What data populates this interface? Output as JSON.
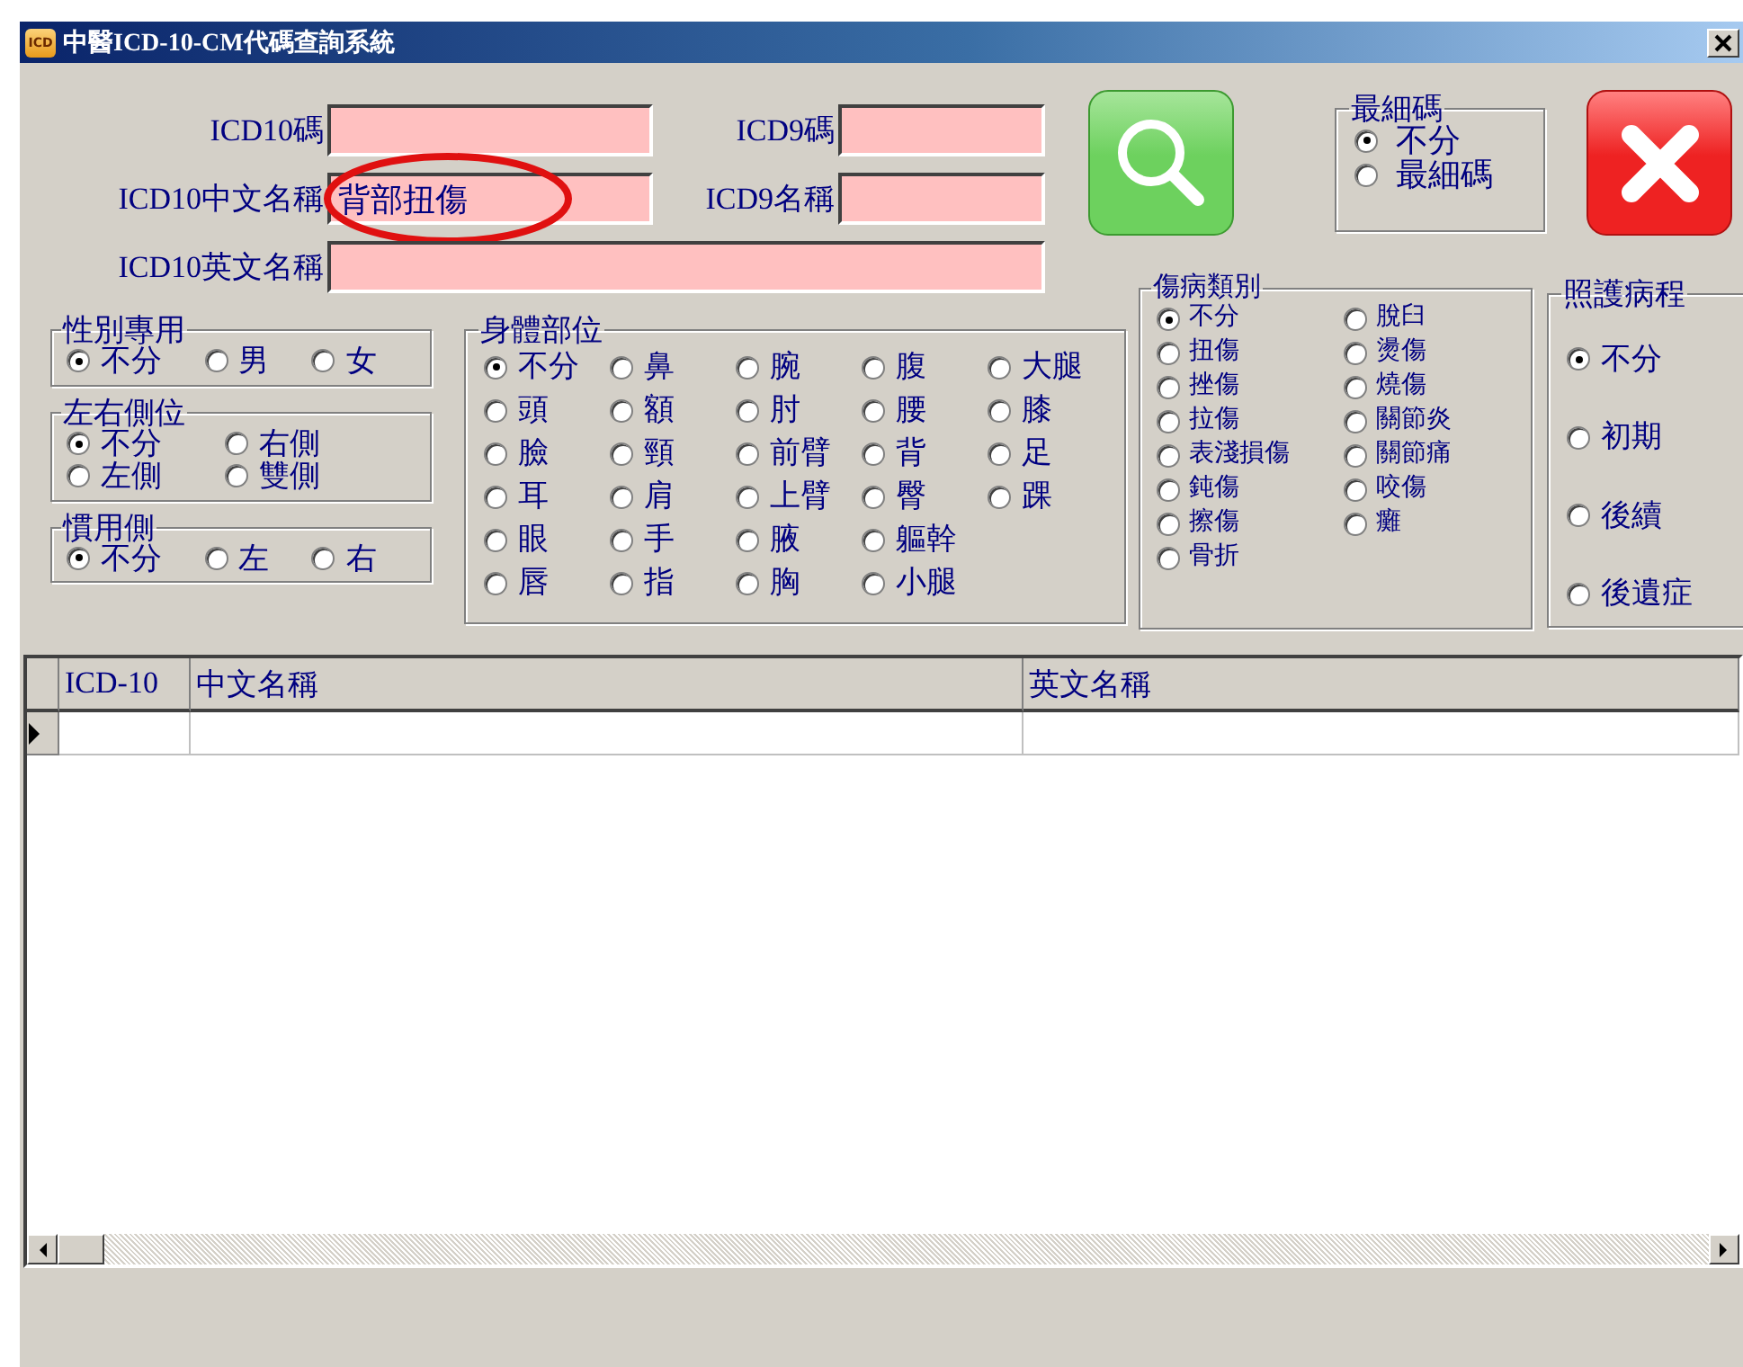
{
  "window": {
    "icon_text": "ICD",
    "title": "中醫ICD-10-CM代碼查詢系統"
  },
  "fields": [
    {
      "label": "ICD10碼"
    },
    {
      "label": "ICD9碼"
    },
    {
      "label": "ICD10中文名稱",
      "value": "背部扭傷",
      "circled": true
    },
    {
      "label": "ICD9名稱"
    },
    {
      "label": "ICD10英文名稱"
    }
  ],
  "finest_code": {
    "title": "最細碼",
    "options": [
      {
        "label": "不分",
        "selected": true
      },
      {
        "label": "最細碼",
        "selected": false
      }
    ]
  },
  "gender": {
    "title": "性別專用",
    "options": [
      {
        "label": "不分",
        "selected": true
      },
      {
        "label": "男",
        "selected": false
      },
      {
        "label": "女",
        "selected": false
      }
    ]
  },
  "laterality": {
    "title": "左右側位",
    "options": [
      {
        "label": "不分",
        "selected": true
      },
      {
        "label": "左側",
        "selected": false
      },
      {
        "label": "右側",
        "selected": false
      },
      {
        "label": "雙側",
        "selected": false
      }
    ]
  },
  "dominant_side": {
    "title": "慣用側",
    "options": [
      {
        "label": "不分",
        "selected": true
      },
      {
        "label": "左",
        "selected": false
      },
      {
        "label": "右",
        "selected": false
      }
    ]
  },
  "body_part": {
    "title": "身體部位",
    "options": [
      {
        "label": "不分",
        "selected": true
      },
      {
        "label": "頭",
        "selected": false
      },
      {
        "label": "臉",
        "selected": false
      },
      {
        "label": "耳",
        "selected": false
      },
      {
        "label": "眼",
        "selected": false
      },
      {
        "label": "唇",
        "selected": false
      },
      {
        "label": "鼻",
        "selected": false
      },
      {
        "label": "額",
        "selected": false
      },
      {
        "label": "頸",
        "selected": false
      },
      {
        "label": "肩",
        "selected": false
      },
      {
        "label": "手",
        "selected": false
      },
      {
        "label": "指",
        "selected": false
      },
      {
        "label": "腕",
        "selected": false
      },
      {
        "label": "肘",
        "selected": false
      },
      {
        "label": "前臂",
        "selected": false
      },
      {
        "label": "上臂",
        "selected": false
      },
      {
        "label": "腋",
        "selected": false
      },
      {
        "label": "胸",
        "selected": false
      },
      {
        "label": "腹",
        "selected": false
      },
      {
        "label": "腰",
        "selected": false
      },
      {
        "label": "背",
        "selected": false
      },
      {
        "label": "臀",
        "selected": false
      },
      {
        "label": "軀幹",
        "selected": false
      },
      {
        "label": "小腿",
        "selected": false
      },
      {
        "label": "大腿",
        "selected": false
      },
      {
        "label": "膝",
        "selected": false
      },
      {
        "label": "足",
        "selected": false
      },
      {
        "label": "踝",
        "selected": false
      }
    ]
  },
  "injury_type": {
    "title": "傷病類別",
    "options": [
      {
        "label": "不分",
        "selected": true
      },
      {
        "label": "扭傷",
        "selected": false
      },
      {
        "label": "挫傷",
        "selected": false
      },
      {
        "label": "拉傷",
        "selected": false
      },
      {
        "label": "表淺損傷",
        "selected": false
      },
      {
        "label": "鈍傷",
        "selected": false
      },
      {
        "label": "擦傷",
        "selected": false
      },
      {
        "label": "骨折",
        "selected": false
      },
      {
        "label": "脫臼",
        "selected": false
      },
      {
        "label": "燙傷",
        "selected": false
      },
      {
        "label": "燒傷",
        "selected": false
      },
      {
        "label": "關節炎",
        "selected": false
      },
      {
        "label": "關節痛",
        "selected": false
      },
      {
        "label": "咬傷",
        "selected": false
      },
      {
        "label": "癱",
        "selected": false
      }
    ]
  },
  "care_stage": {
    "title": "照護病程",
    "options": [
      {
        "label": "不分",
        "selected": true
      },
      {
        "label": "初期",
        "selected": false
      },
      {
        "label": "後續",
        "selected": false
      },
      {
        "label": "後遺症",
        "selected": false
      }
    ]
  },
  "table": {
    "columns": [
      "ICD-10",
      "中文名稱",
      "英文名稱"
    ],
    "rows": [
      {
        "current": true
      }
    ]
  }
}
